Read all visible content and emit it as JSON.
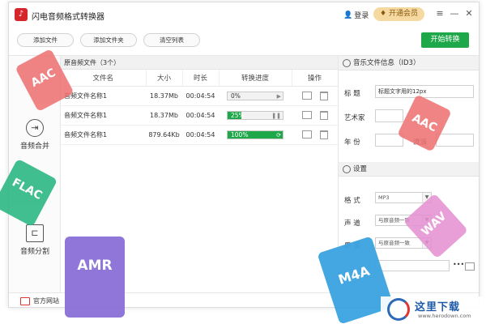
{
  "app": {
    "title": "闪电音频格式转换器",
    "login": "登录",
    "vip": "开通会员"
  },
  "toolbar": {
    "add_file": "添加文件",
    "add_folder": "添加文件夹",
    "clear_list": "清空列表",
    "start": "开始转换"
  },
  "nav": {
    "merge": "音频合并",
    "split": "音频分割"
  },
  "bottom": {
    "official_site": "官方网站"
  },
  "files": {
    "header": "原音频文件（3个）",
    "columns": [
      "文件名",
      "大小",
      "时长",
      "转换进度",
      "操作"
    ],
    "rows": [
      {
        "name": "音频文件名称1",
        "size": "18.37Mb",
        "duration": "00:04:54",
        "progress_label": "0%",
        "progress": 0
      },
      {
        "name": "音频文件名称1",
        "size": "18.37Mb",
        "duration": "00:04:54",
        "progress_label": "25%",
        "progress": 25
      },
      {
        "name": "音频文件名称1",
        "size": "879.64Kb",
        "duration": "00:04:54",
        "progress_label": "100%",
        "progress": 100
      }
    ]
  },
  "id3": {
    "header": "音乐文件信息（ID3）",
    "title_label": "标  题",
    "title_value": "标题文字用的12px",
    "artist_label": "艺术家",
    "year_label": "年  份",
    "genre_label": "流派"
  },
  "settings": {
    "header": "设置",
    "format_label": "格  式",
    "format_value": "MP3",
    "channel_label": "声  道",
    "channel_value": "与原音频一致",
    "quality_label": "质  量",
    "quality_value": "与原音频一致"
  },
  "badges": {
    "aac": "AAC",
    "flac": "FLAC",
    "amr": "AMR",
    "m4a": "M4A",
    "wav": "WAV",
    "aac2": "AAC"
  },
  "watermark": {
    "cn": "这里下载",
    "url": "www.herodown.com"
  },
  "colors": {
    "accent": "#1ea84a",
    "brand": "#d7262b",
    "vip": "#f5d9a0"
  }
}
